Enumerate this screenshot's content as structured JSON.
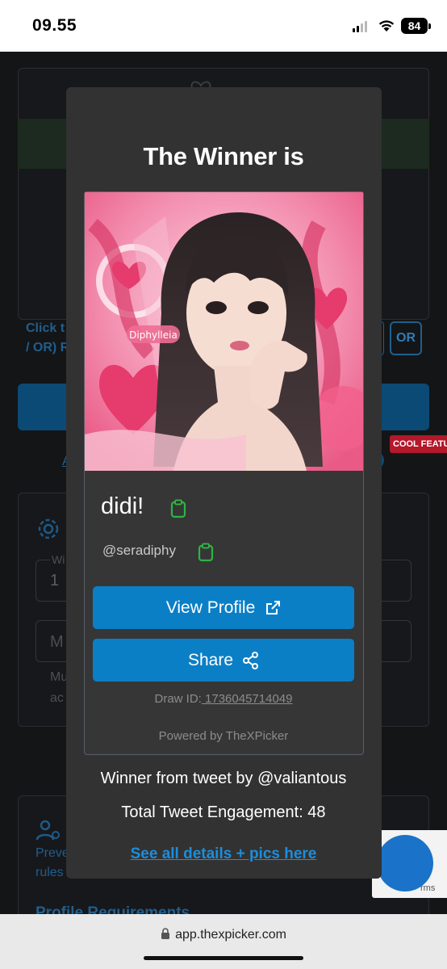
{
  "status_bar": {
    "time": "09.55",
    "battery": "84"
  },
  "background_app": {
    "click_text_line1": "Click t",
    "click_text_line2": "/ OR) R",
    "or_button": "OR",
    "cool_badge": "COOL FEATU",
    "link_fragment": "A",
    "winners_label": "Wi",
    "winners_value": "1",
    "input_fragment": "M",
    "help_line1": "Mu",
    "help_line2": "ac",
    "prevent_line1": "Preve",
    "prevent_line2": "rules",
    "profile_req": "Profile Requirements"
  },
  "modal": {
    "title": "The Winner is",
    "image_caption": "Diphylleia",
    "winner_name": "didi!",
    "winner_handle": "@seradiphy",
    "view_profile_label": "View Profile",
    "share_label": "Share",
    "draw_id_label": "Draw ID:",
    "draw_id_value": " 1736045714049",
    "powered_by": "Powered by TheXPicker",
    "tweet_by": "Winner from tweet by @valiantous",
    "engagement": "Total Tweet Engagement: 48",
    "details_link": "See all details + pics here"
  },
  "recaptcha": {
    "text": "rms"
  },
  "browser": {
    "url": "app.thexpicker.com"
  },
  "colors": {
    "accent_blue": "#0b7fc6",
    "link_blue": "#1c8ddb",
    "clipboard_green": "#2fb344",
    "modal_bg": "#323232"
  },
  "icons": [
    "clipboard-icon",
    "external-link-icon",
    "share-icon",
    "lock-icon",
    "gear-icon",
    "user-gear-icon",
    "wifi-icon",
    "heart-icon"
  ]
}
